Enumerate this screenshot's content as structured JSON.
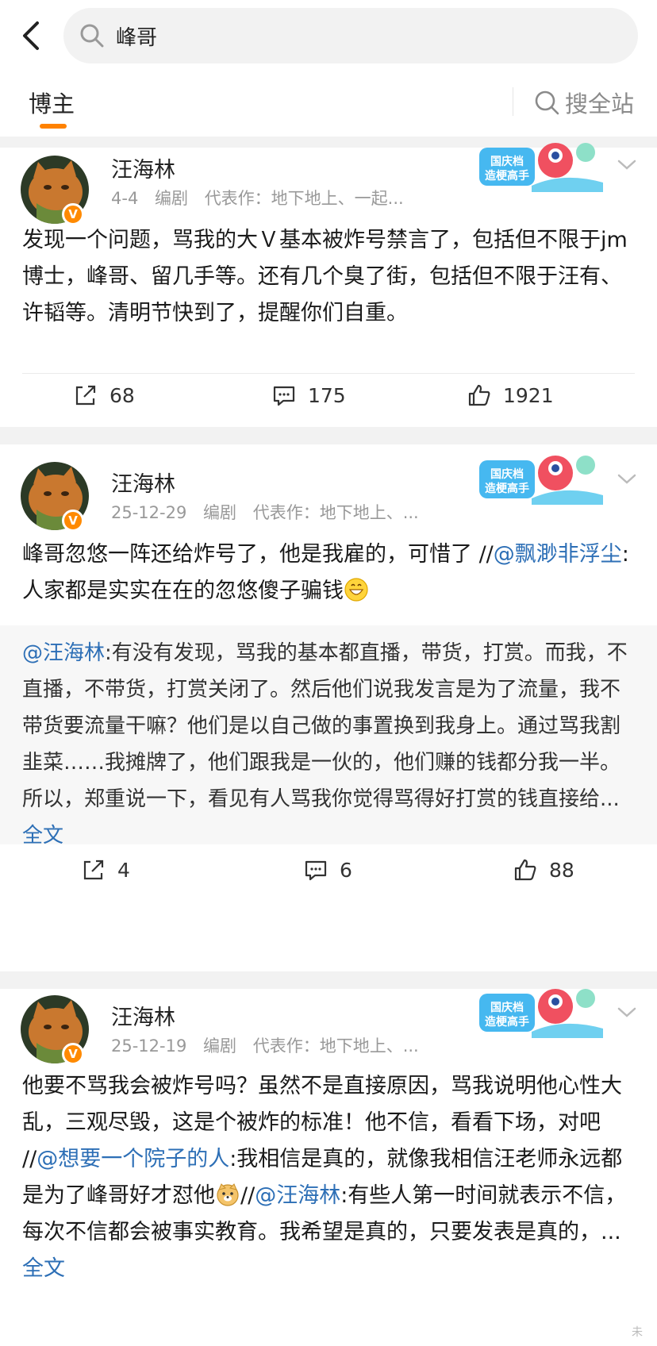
{
  "search": {
    "query": "峰哥"
  },
  "tabs": {
    "bloggers": "博主",
    "search_all": "搜全站"
  },
  "posts": [
    {
      "author": "汪海林",
      "date": "4-4",
      "role": "编剧",
      "works": "代表作：地下地上、一起...",
      "badge_text": "国庆档 造梗高手",
      "content": "发现一个问题，骂我的大Ｖ基本被炸号禁言了，包括但不限于jm博士，峰哥、留几手等。还有几个臭了街，包括但不限于汪有、许韬等。清明节快到了，提醒你们自重。",
      "reposts": "68",
      "comments": "175",
      "likes": "1921"
    },
    {
      "author": "汪海林",
      "date": "25-12-29",
      "role": "编剧",
      "works": "代表作：地下地上、...",
      "badge_text": "国庆档 造梗高手",
      "content_a": "峰哥忽悠一阵还给炸号了，他是我雇的，可惜了 //",
      "mention": "@飘渺非浮尘",
      "content_b": ":人家都是实实在在的忽悠傻子骗钱",
      "quote_mention": "@汪海林",
      "quote_text": ":有没有发现，骂我的基本都直播，带货，打赏。而我，不直播，不带货，打赏关闭了。然后他们说我发言是为了流量，我不带货要流量干嘛？他们是以自己做的事置换到我身上。通过骂我割韭菜……我摊牌了，他们跟我是一伙的，他们赚的钱都分我一半。所以，郑重说一下，看见有人骂我你觉得骂得好打赏的钱直接给... ",
      "quote_full": "全文",
      "reposts": "4",
      "comments": "6",
      "likes": "88"
    },
    {
      "author": "汪海林",
      "date": "25-12-19",
      "role": "编剧",
      "works": "代表作：地下地上、...",
      "badge_text": "国庆档 造梗高手",
      "content_a": "他要不骂我会被炸号吗？虽然不是直接原因，骂我说明他心性大乱，三观尽毁，这是个被炸的标准！他不信，看看下场，对吧 //",
      "mention_a": "@想要一个院子的人",
      "content_b": ":我相信是真的，就像我相信汪老师永远都是为了峰哥好才怼他",
      "content_c": "//",
      "mention_b": "@汪海林",
      "content_d": ":有些人第一时间就表示不信，每次不信都会被事实教育。我希望是真的，只要发表是真的，... ",
      "full": "全文"
    }
  ],
  "watermark": "未",
  "colors": {
    "accent": "#ff8200",
    "link": "#2d6fb6",
    "vip": "#ff8a00"
  }
}
